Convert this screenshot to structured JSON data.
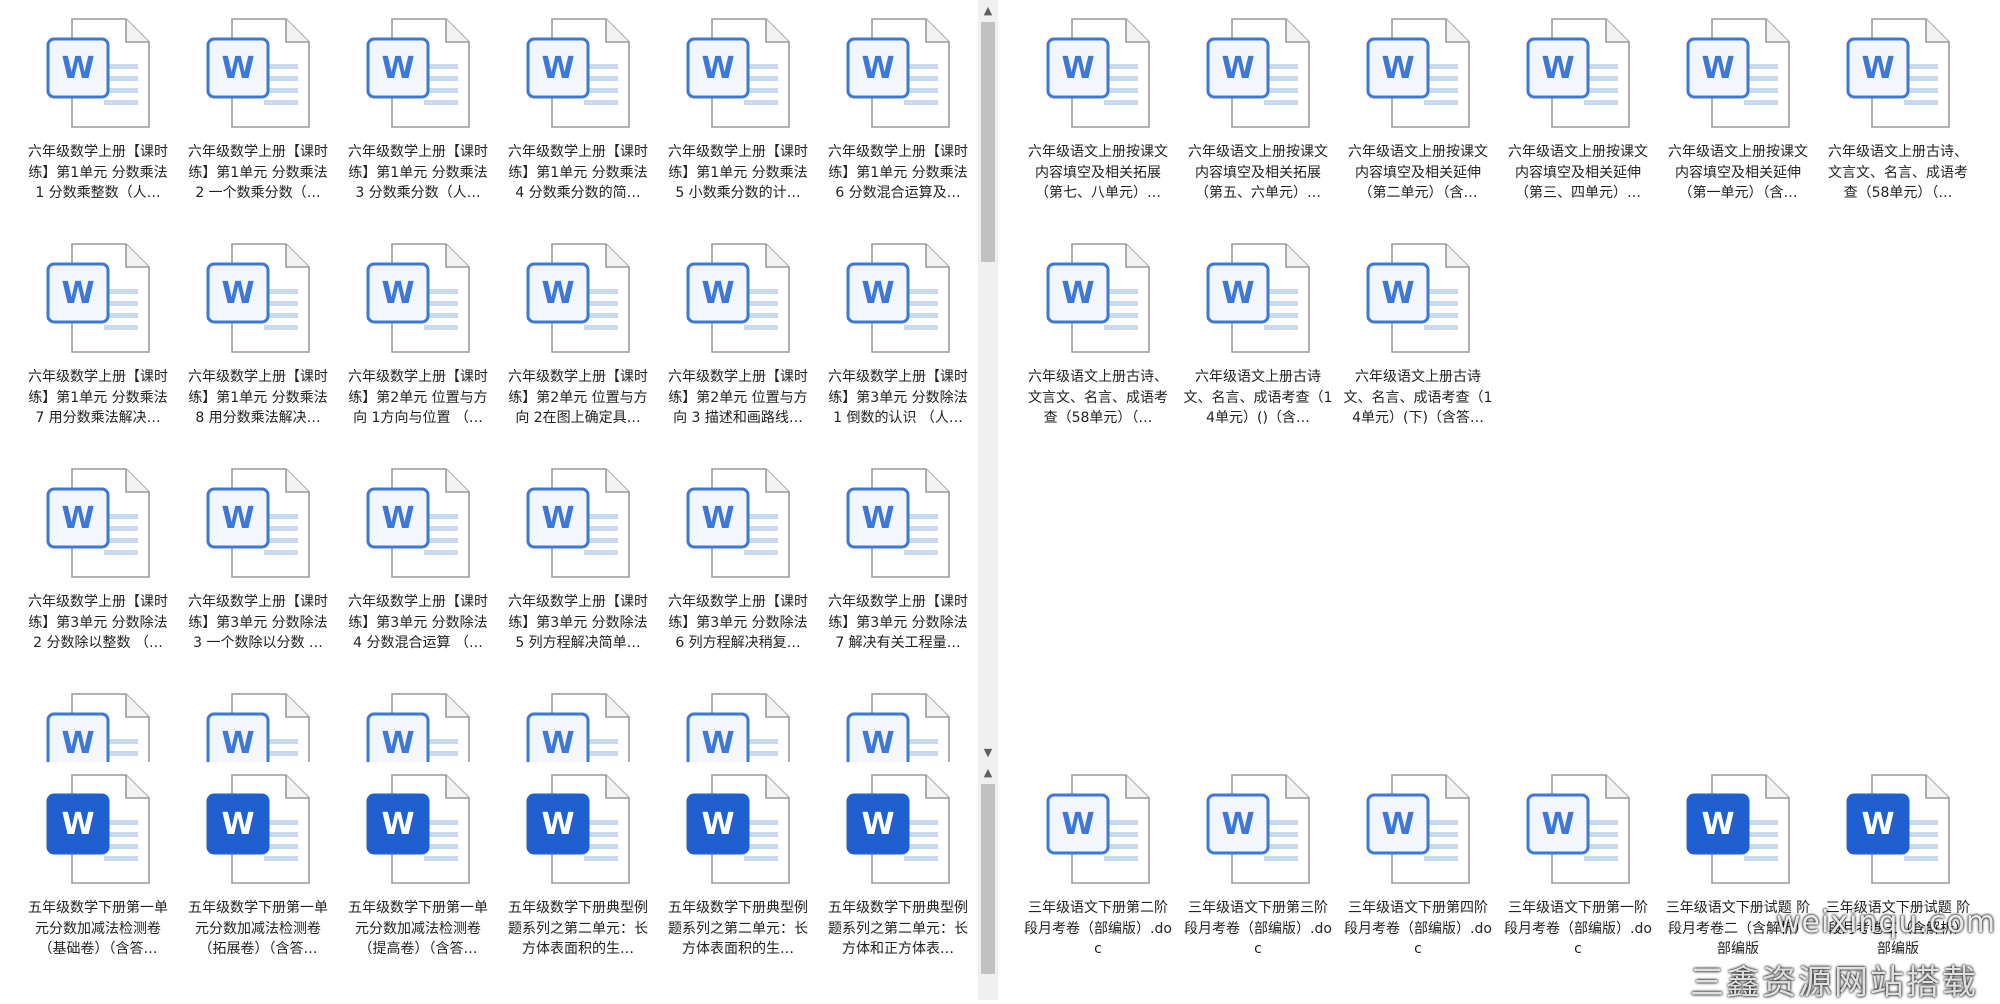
{
  "colors": {
    "word_light": "#3D78D6",
    "word_solid": "#1F5FD0",
    "page_bg": "#ffffff",
    "scroll_track": "#f0f0f0",
    "scroll_thumb": "#c1c1c1"
  },
  "icon": {
    "name": "word-document-icon",
    "letter": "W"
  },
  "scroll": {
    "up": "▲",
    "down": "▼"
  },
  "panes": {
    "top_left": {
      "files": [
        "六年级数学上册【课时练】第1单元 分数乘法 1 分数乘整数（人…",
        "六年级数学上册【课时练】第1单元 分数乘法 2 一个数乘分数（…",
        "六年级数学上册【课时练】第1单元 分数乘法 3 分数乘分数（人…",
        "六年级数学上册【课时练】第1单元 分数乘法 4 分数乘分数的简…",
        "六年级数学上册【课时练】第1单元 分数乘法 5 小数乘分数的计…",
        "六年级数学上册【课时练】第1单元 分数乘法 6 分数混合运算及…",
        "六年级数学上册【课时练】第1单元 分数乘法 7 用分数乘法解决…",
        "六年级数学上册【课时练】第1单元 分数乘法 8 用分数乘法解决…",
        "六年级数学上册【课时练】第2单元 位置与方向 1方向与位置 （…",
        "六年级数学上册【课时练】第2单元 位置与方向 2在图上确定具…",
        "六年级数学上册【课时练】第2单元 位置与方向 3 描述和画路线…",
        "六年级数学上册【课时练】第3单元 分数除法 1 倒数的认识 （人…",
        "六年级数学上册【课时练】第3单元 分数除法 2 分数除以整数 （…",
        "六年级数学上册【课时练】第3单元 分数除法 3 一个数除以分数 …",
        "六年级数学上册【课时练】第3单元 分数除法 4 分数混合运算 （…",
        "六年级数学上册【课时练】第3单元 分数除法 5 列方程解决简单…",
        "六年级数学上册【课时练】第3单元 分数除法 6 列方程解决稍复…",
        "六年级数学上册【课时练】第3单元 分数除法 7 解决有关工程量…",
        "",
        "",
        "",
        "",
        "",
        ""
      ]
    },
    "top_right": {
      "files": [
        "六年级语文上册按课文内容填空及相关拓展（第七、八单元）…",
        "六年级语文上册按课文内容填空及相关拓展（第五、六单元）…",
        "六年级语文上册按课文内容填空及相关延伸（第二单元）（含…",
        "六年级语文上册按课文内容填空及相关延伸（第三、四单元）…",
        "六年级语文上册按课文内容填空及相关延伸（第一单元）（含…",
        "六年级语文上册古诗、文言文、名言、成语考查（58单元）（…",
        "六年级语文上册古诗、文言文、名言、成语考查（58单元）（…",
        "六年级语文上册古诗文、名言、成语考查（14单元）()（含…",
        "六年级语文上册古诗文、名言、成语考查（14单元）(下)（含答…"
      ]
    },
    "bottom_left": {
      "files": [
        "五年级数学下册第一单元分数加减法检测卷（基础卷）（含答…",
        "五年级数学下册第一单元分数加减法检测卷（拓展卷）（含答…",
        "五年级数学下册第一单元分数加减法检测卷（提高卷）（含答…",
        "五年级数学下册典型例题系列之第二单元：长方体表面积的生…",
        "五年级数学下册典型例题系列之第二单元：长方体表面积的生…",
        "五年级数学下册典型例题系列之第二单元：长方体和正方体表…"
      ]
    },
    "bottom_right": {
      "files": [
        "三年级语文下册第二阶段月考卷（部编版）.doc",
        "三年级语文下册第三阶段月考卷（部编版）.doc",
        "三年级语文下册第四阶段月考卷（部编版）.doc",
        "三年级语文下册第一阶段月考卷（部编版）.doc",
        "三年级语文下册试题 阶段月考卷二（含解析）部编版",
        "三年级语文下册试题 阶段月考卷三（含解析）部编版"
      ]
    }
  },
  "watermark": {
    "line1": "weixinqu.com",
    "line2": "三鑫资源网站搭载"
  }
}
